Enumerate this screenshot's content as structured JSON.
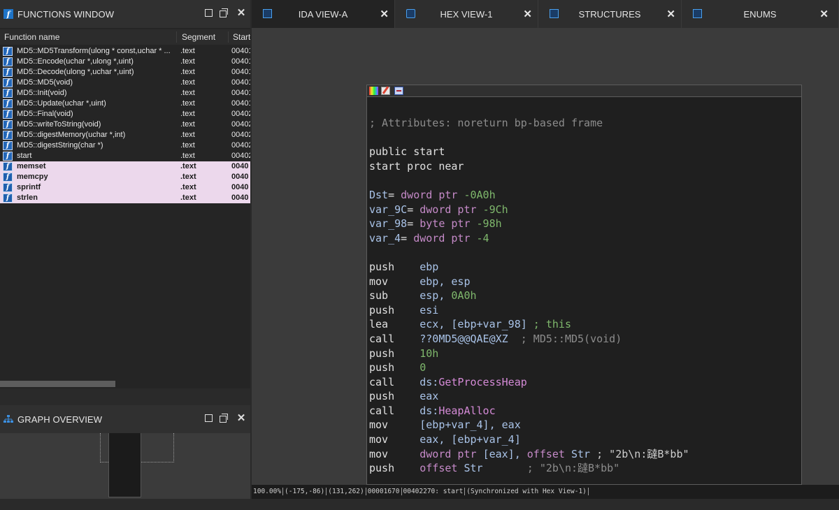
{
  "functions_window": {
    "title": "FUNCTIONS WINDOW",
    "columns": [
      "Function name",
      "Segment",
      "Start"
    ],
    "rows": [
      {
        "name": "MD5::MD5Transform(ulong * const,uchar * ...",
        "segment": ".text",
        "start": "00401",
        "library": false
      },
      {
        "name": "MD5::Encode(uchar *,ulong *,uint)",
        "segment": ".text",
        "start": "00401",
        "library": false
      },
      {
        "name": "MD5::Decode(ulong *,uchar *,uint)",
        "segment": ".text",
        "start": "00401",
        "library": false
      },
      {
        "name": "MD5::MD5(void)",
        "segment": ".text",
        "start": "00401",
        "library": false
      },
      {
        "name": "MD5::Init(void)",
        "segment": ".text",
        "start": "00401",
        "library": false
      },
      {
        "name": "MD5::Update(uchar *,uint)",
        "segment": ".text",
        "start": "00401",
        "library": false
      },
      {
        "name": "MD5::Final(void)",
        "segment": ".text",
        "start": "00402",
        "library": false
      },
      {
        "name": "MD5::writeToString(void)",
        "segment": ".text",
        "start": "00402",
        "library": false
      },
      {
        "name": "MD5::digestMemory(uchar *,int)",
        "segment": ".text",
        "start": "00402",
        "library": false
      },
      {
        "name": "MD5::digestString(char *)",
        "segment": ".text",
        "start": "00402",
        "library": false
      },
      {
        "name": "start",
        "segment": ".text",
        "start": "00402",
        "library": false
      },
      {
        "name": "memset",
        "segment": ".text",
        "start": "0040",
        "library": true
      },
      {
        "name": "memcpy",
        "segment": ".text",
        "start": "0040",
        "library": true
      },
      {
        "name": "sprintf",
        "segment": ".text",
        "start": "0040",
        "library": true
      },
      {
        "name": "strlen",
        "segment": ".text",
        "start": "0040",
        "library": true
      }
    ]
  },
  "graph_overview": {
    "title": "GRAPH OVERVIEW"
  },
  "tabs": [
    {
      "label": "IDA VIEW-A",
      "icon": "ida-view-icon",
      "active": true
    },
    {
      "label": "HEX VIEW-1",
      "icon": "hex-view-icon",
      "active": false
    },
    {
      "label": "STRUCTURES",
      "icon": "structures-icon",
      "active": false
    },
    {
      "label": "ENUMS",
      "icon": "enums-icon",
      "active": false
    }
  ],
  "disassembly": [
    [
      {
        "t": "; Attributes: noreturn bp-based frame",
        "c": "comment"
      }
    ],
    [],
    [
      {
        "t": "public start",
        "c": "kw"
      }
    ],
    [
      {
        "t": "start proc near",
        "c": "kw"
      }
    ],
    [],
    [
      {
        "t": "Dst",
        "c": "var"
      },
      {
        "t": "= ",
        "c": "kw"
      },
      {
        "t": "dword ptr ",
        "c": "type"
      },
      {
        "t": "-0A0h",
        "c": "num"
      }
    ],
    [
      {
        "t": "var_9C",
        "c": "var"
      },
      {
        "t": "= ",
        "c": "kw"
      },
      {
        "t": "dword ptr ",
        "c": "type"
      },
      {
        "t": "-9Ch",
        "c": "num"
      }
    ],
    [
      {
        "t": "var_98",
        "c": "var"
      },
      {
        "t": "= ",
        "c": "kw"
      },
      {
        "t": "byte ptr ",
        "c": "type"
      },
      {
        "t": "-98h",
        "c": "num"
      }
    ],
    [
      {
        "t": "var_4",
        "c": "var"
      },
      {
        "t": "= ",
        "c": "kw"
      },
      {
        "t": "dword ptr ",
        "c": "type"
      },
      {
        "t": "-4",
        "c": "num"
      }
    ],
    [],
    [
      {
        "t": "push    ",
        "c": "kw"
      },
      {
        "t": "ebp",
        "c": "name"
      }
    ],
    [
      {
        "t": "mov     ",
        "c": "kw"
      },
      {
        "t": "ebp, esp",
        "c": "name"
      }
    ],
    [
      {
        "t": "sub     ",
        "c": "kw"
      },
      {
        "t": "esp, ",
        "c": "name"
      },
      {
        "t": "0A0h",
        "c": "num"
      }
    ],
    [
      {
        "t": "push    ",
        "c": "kw"
      },
      {
        "t": "esi",
        "c": "name"
      }
    ],
    [
      {
        "t": "lea     ",
        "c": "kw"
      },
      {
        "t": "ecx, [ebp+var_98]",
        "c": "name"
      },
      {
        "t": " ; this",
        "c": "num"
      }
    ],
    [
      {
        "t": "call    ",
        "c": "kw"
      },
      {
        "t": "??0MD5@@QAE@XZ",
        "c": "name"
      },
      {
        "t": "  ; MD5::MD5(void)",
        "c": "comment"
      }
    ],
    [
      {
        "t": "push    ",
        "c": "kw"
      },
      {
        "t": "10h",
        "c": "num"
      }
    ],
    [
      {
        "t": "push    ",
        "c": "kw"
      },
      {
        "t": "0",
        "c": "num"
      }
    ],
    [
      {
        "t": "call    ",
        "c": "kw"
      },
      {
        "t": "ds:",
        "c": "name"
      },
      {
        "t": "GetProcessHeap",
        "c": "api"
      }
    ],
    [
      {
        "t": "push    ",
        "c": "kw"
      },
      {
        "t": "eax",
        "c": "name"
      }
    ],
    [
      {
        "t": "call    ",
        "c": "kw"
      },
      {
        "t": "ds:",
        "c": "name"
      },
      {
        "t": "HeapAlloc",
        "c": "api"
      }
    ],
    [
      {
        "t": "mov     ",
        "c": "kw"
      },
      {
        "t": "[ebp+var_4], eax",
        "c": "name"
      }
    ],
    [
      {
        "t": "mov     ",
        "c": "kw"
      },
      {
        "t": "eax, [ebp+var_4]",
        "c": "name"
      }
    ],
    [
      {
        "t": "mov     ",
        "c": "kw"
      },
      {
        "t": "dword ptr ",
        "c": "type"
      },
      {
        "t": "[eax], ",
        "c": "name"
      },
      {
        "t": "offset ",
        "c": "type"
      },
      {
        "t": "Str",
        "c": "name"
      },
      {
        "t": " ; \"2b\\n:躂B*bb\"",
        "c": "str"
      }
    ],
    [
      {
        "t": "push    ",
        "c": "kw"
      },
      {
        "t": "offset ",
        "c": "type"
      },
      {
        "t": "Str",
        "c": "name"
      },
      {
        "t": "       ; \"2b\\n:躂B*bb\"",
        "c": "comment"
      }
    ]
  ],
  "status_bar": {
    "zoom": "100.00%",
    "coords1": "(-175,-86)",
    "coords2": "(131,262)",
    "offset": "00001670",
    "location": "00402270: start",
    "sync": "(Synchronized with Hex View-1)"
  },
  "colors": {
    "library_row": "#ecd8ec",
    "accent": "#1e74c8"
  }
}
